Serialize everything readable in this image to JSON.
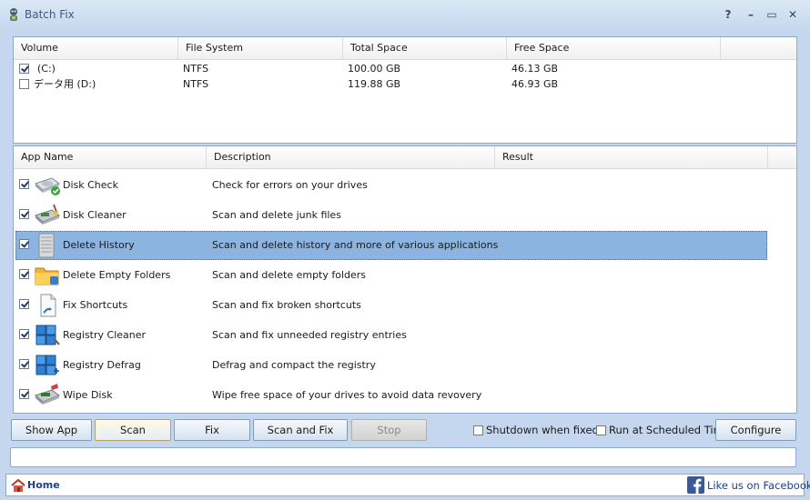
{
  "window": {
    "title": "Batch Fix"
  },
  "controls": {
    "help": "?",
    "minimize": "–",
    "maximize": "▭",
    "close": "✕"
  },
  "volumes": {
    "columns": [
      "Volume",
      "File System",
      "Total Space",
      "Free Space"
    ],
    "rows": [
      {
        "checked": true,
        "volume": "(C:)",
        "fs": "NTFS",
        "total": "100.00 GB",
        "free": "46.13 GB"
      },
      {
        "checked": false,
        "volume": "データ用 (D:)",
        "fs": "NTFS",
        "total": "119.88 GB",
        "free": "46.93 GB"
      }
    ]
  },
  "apps": {
    "columns": [
      "App Name",
      "Description",
      "Result"
    ],
    "rows": [
      {
        "checked": true,
        "name": "Disk Check",
        "desc": "Check for errors on your drives",
        "result": "",
        "icon": "disk-check-icon"
      },
      {
        "checked": true,
        "name": "Disk Cleaner",
        "desc": "Scan and delete junk files",
        "result": "",
        "icon": "disk-cleaner-icon"
      },
      {
        "checked": true,
        "name": "Delete History",
        "desc": "Scan and delete history and more of various applications",
        "result": "",
        "icon": "delete-history-icon",
        "selected": true
      },
      {
        "checked": true,
        "name": "Delete Empty Folders",
        "desc": "Scan and delete empty folders",
        "result": "",
        "icon": "folder-icon"
      },
      {
        "checked": true,
        "name": "Fix Shortcuts",
        "desc": "Scan and fix broken shortcuts",
        "result": "",
        "icon": "shortcut-icon"
      },
      {
        "checked": true,
        "name": "Registry Cleaner",
        "desc": "Scan and fix unneeded registry entries",
        "result": "",
        "icon": "registry-cleaner-icon"
      },
      {
        "checked": true,
        "name": "Registry Defrag",
        "desc": "Defrag and compact the registry",
        "result": "",
        "icon": "registry-defrag-icon"
      },
      {
        "checked": true,
        "name": "Wipe Disk",
        "desc": "Wipe free space of your drives to avoid data revovery",
        "result": "",
        "icon": "wipe-disk-icon"
      }
    ]
  },
  "toolbar": {
    "show_app": "Show App",
    "scan": "Scan",
    "fix": "Fix",
    "scan_and_fix": "Scan and Fix",
    "stop": "Stop",
    "shutdown_label": "Shutdown when fixed",
    "shutdown_checked": false,
    "scheduled_label": "Run at Scheduled Time",
    "scheduled_checked": false,
    "configure": "Configure"
  },
  "footer": {
    "home": "Home",
    "facebook": "Like us on Facebook."
  },
  "colors": {
    "selection": "#8cb4e0",
    "home_text": "#1f3f8a",
    "facebook_blue": "#3b5998"
  }
}
